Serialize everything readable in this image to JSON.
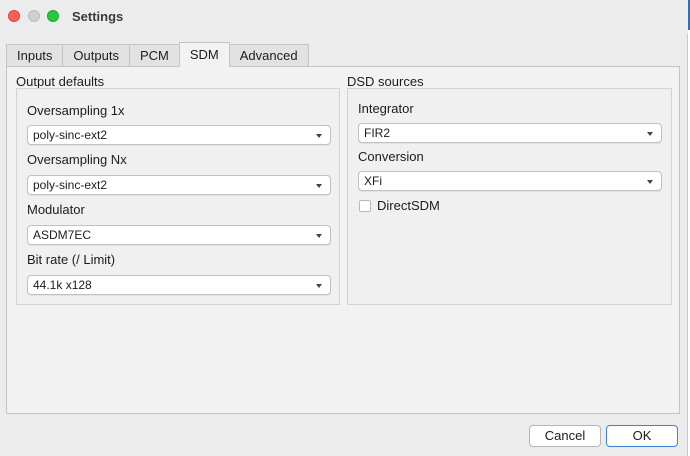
{
  "window": {
    "title": "Settings"
  },
  "tabs": [
    {
      "label": "Inputs"
    },
    {
      "label": "Outputs"
    },
    {
      "label": "PCM"
    },
    {
      "label": "SDM",
      "active": true
    },
    {
      "label": "Advanced"
    }
  ],
  "output_defaults": {
    "heading": "Output defaults",
    "oversampling_1x": {
      "label": "Oversampling 1x",
      "value": "poly-sinc-ext2"
    },
    "oversampling_nx": {
      "label": "Oversampling Nx",
      "value": "poly-sinc-ext2"
    },
    "modulator": {
      "label": "Modulator",
      "value": "ASDM7EC"
    },
    "bit_rate": {
      "label": "Bit rate (/ Limit)",
      "value": "44.1k x128"
    }
  },
  "dsd_sources": {
    "heading": "DSD sources",
    "integrator": {
      "label": "Integrator",
      "value": "FIR2"
    },
    "conversion": {
      "label": "Conversion",
      "value": "XFi"
    },
    "direct_sdm": {
      "label": "DirectSDM",
      "checked": false
    }
  },
  "buttons": {
    "cancel": "Cancel",
    "ok": "OK"
  },
  "colors": {
    "close": "#fe5f57",
    "minimize_disabled": "#cfcfcf",
    "zoom": "#28c840",
    "default_button_border": "#3c82d6"
  }
}
